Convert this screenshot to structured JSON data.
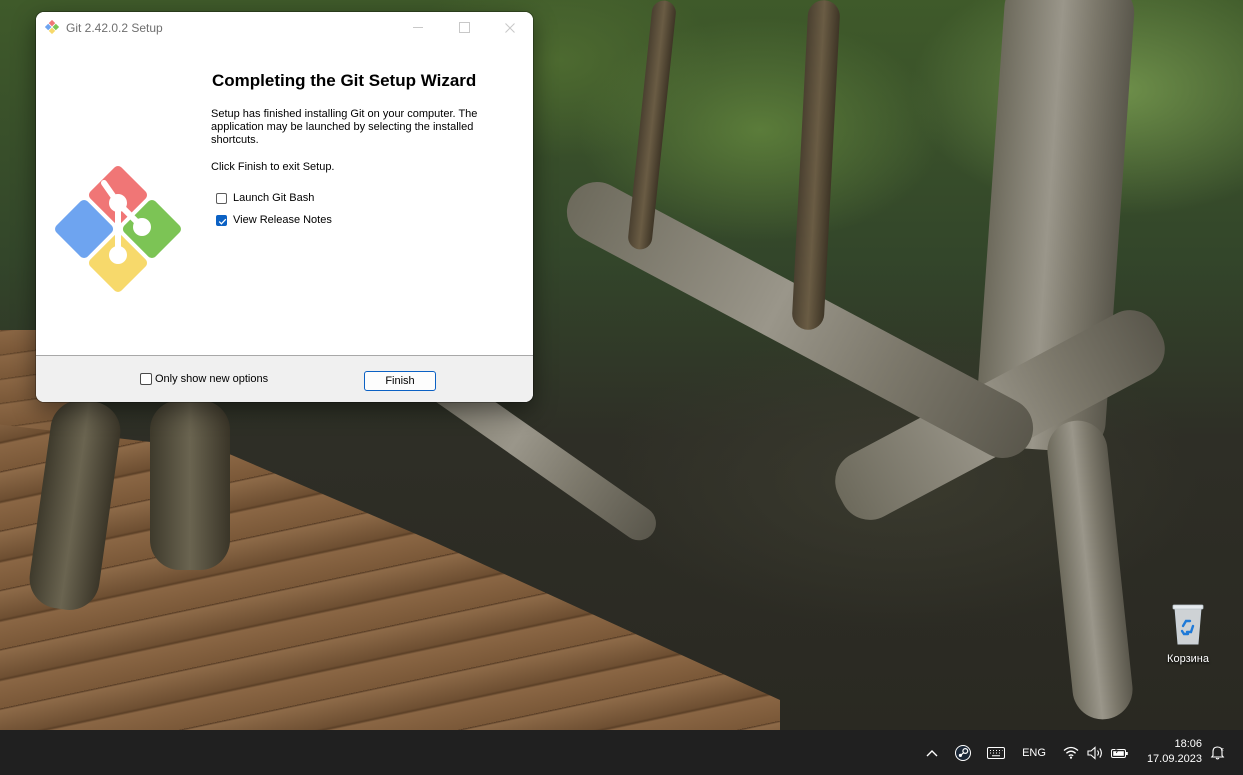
{
  "window": {
    "title": "Git 2.42.0.2 Setup",
    "heading": "Completing the Git Setup Wizard",
    "paragraph1": "Setup has finished installing Git on your computer. The application may be launched by selecting the installed shortcuts.",
    "paragraph2": "Click Finish to exit Setup.",
    "options": [
      {
        "label": "Launch Git Bash",
        "checked": false
      },
      {
        "label": "View Release Notes",
        "checked": true
      }
    ],
    "footer": {
      "only_new_label": "Only show new options",
      "only_new_checked": false,
      "finish_label": "Finish"
    }
  },
  "desktop": {
    "recycle_bin_label": "Корзина"
  },
  "taskbar": {
    "language": "ENG",
    "time": "18:06",
    "date": "17.09.2023"
  },
  "colors": {
    "accent": "#0b61c4",
    "git_red": "#f07676",
    "git_green": "#7cc455",
    "git_blue": "#6ea4f0",
    "git_yellow": "#f7d96b"
  }
}
